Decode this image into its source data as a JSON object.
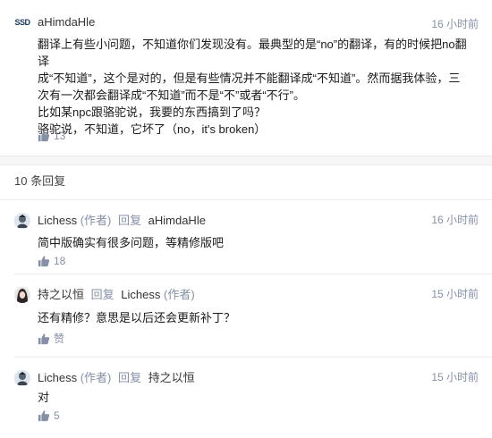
{
  "main_comment": {
    "avatar_text": "SSD",
    "author": "aHimdaHle",
    "time": "16 小时前",
    "body": "翻译上有些小问题，不知道你们发现没有。最典型的是“no”的翻译，有的时候把no翻译\n成“不知道”，这个是对的，但是有些情况并不能翻译成“不知道”。然而据我体验，三\n次有一次都会翻译成“不知道”而不是“不”或者“不行”。\n比如某npc跟骆驼说，我要的东西搞到了吗？\n骆驼说，不知道，它坏了（no，it's broken）",
    "likes": "13"
  },
  "replies_header": "10 条回复",
  "replies": [
    {
      "author": "Lichess",
      "author_tag": "(作者)",
      "verb": "回复",
      "target": "aHimdaHle",
      "target_tag": "",
      "time": "16 小时前",
      "text": "简中版确实有很多问题，等精修版吧",
      "likes": "18"
    },
    {
      "author": "持之以恒",
      "author_tag": "",
      "verb": "回复",
      "target": "Lichess",
      "target_tag": "(作者)",
      "time": "15 小时前",
      "text": "还有精修？意思是以后还会更新补丁？",
      "likes": "赞"
    },
    {
      "author": "Lichess",
      "author_tag": "(作者)",
      "verb": "回复",
      "target": "持之以恒",
      "target_tag": "",
      "time": "15 小时前",
      "text": "对",
      "likes": "5"
    }
  ],
  "colors": {
    "meta_gray": "#8590a6",
    "divider": "#ebebeb",
    "band": "#f6f6f6"
  },
  "icons": {
    "like": "thumbs-up-icon"
  }
}
